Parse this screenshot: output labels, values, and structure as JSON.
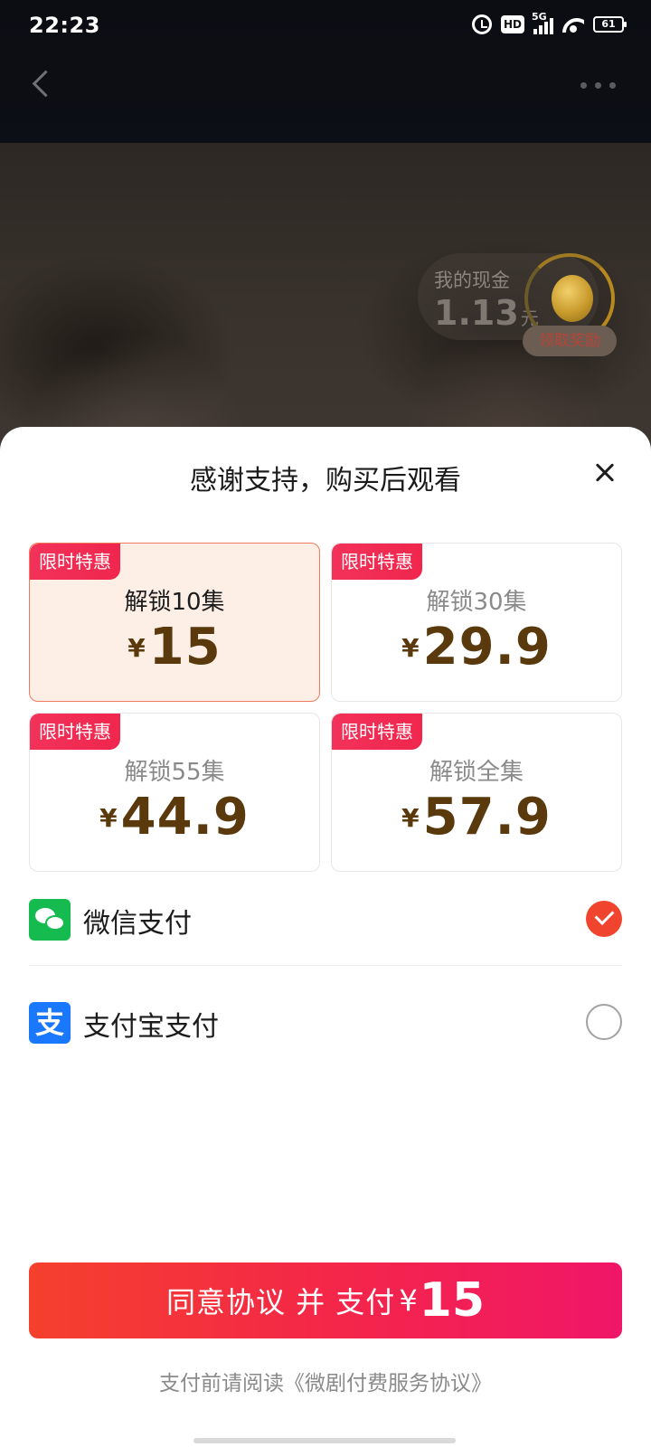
{
  "status_bar": {
    "time": "22:23",
    "hd": "HD",
    "network": "5G",
    "battery": "61"
  },
  "cash": {
    "label": "我的现金",
    "value": "1.13",
    "unit": "元",
    "reward_button": "领取奖励"
  },
  "sheet": {
    "title": "感谢支持，购买后观看",
    "plans": [
      {
        "tag": "限时特惠",
        "name": "解锁10集",
        "currency": "¥",
        "price": "15",
        "selected": true
      },
      {
        "tag": "限时特惠",
        "name": "解锁30集",
        "currency": "¥",
        "price": "29.9",
        "selected": false
      },
      {
        "tag": "限时特惠",
        "name": "解锁55集",
        "currency": "¥",
        "price": "44.9",
        "selected": false
      },
      {
        "tag": "限时特惠",
        "name": "解锁全集",
        "currency": "¥",
        "price": "57.9",
        "selected": false
      }
    ],
    "payment_methods": [
      {
        "label": "微信支付",
        "icon": "wechat-pay-icon",
        "selected": true
      },
      {
        "label": "支付宝支付",
        "icon": "alipay-icon",
        "icon_glyph": "支",
        "selected": false
      }
    ],
    "pay_button": {
      "text": "同意协议 并 支付",
      "currency": "¥",
      "amount": "15"
    },
    "agreement": {
      "prefix": "支付前请阅读",
      "link": "《微剧付费服务协议》"
    }
  },
  "colors": {
    "accent_red": "#f0442e",
    "price_brown": "#5a3a0c",
    "wechat_green": "#15bb4e",
    "alipay_blue": "#1a78ff",
    "tag_red": "#f2325a"
  }
}
